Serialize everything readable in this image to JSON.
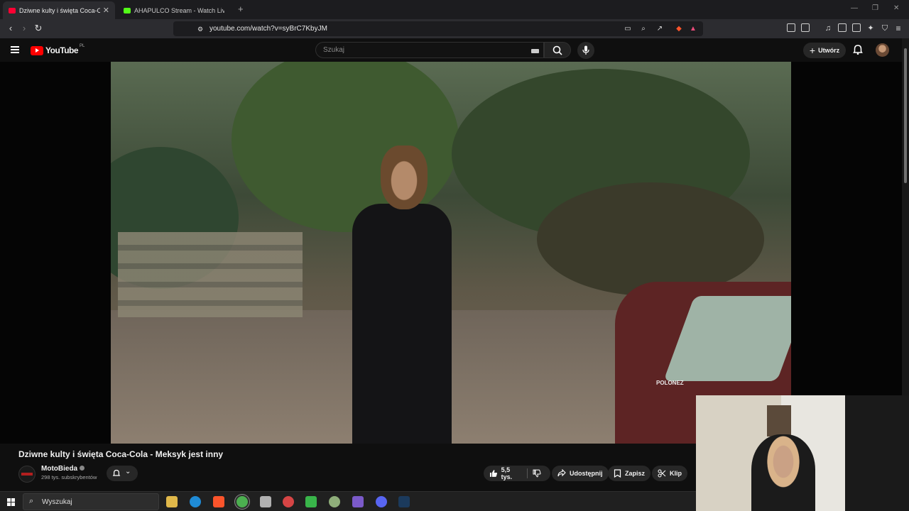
{
  "browser": {
    "tabs": [
      {
        "label": "Dziwne kulty i święta Coca-Cola - Meksyk jest inny",
        "favicon_color": "#ff0033",
        "active": true
      },
      {
        "label": "AHAPULCO Stream - Watch Live on Kick",
        "favicon_color": "#53fc18",
        "active": false
      }
    ],
    "new_tab": "+",
    "url": "youtube.com/watch?v=syBrC7KbyJM"
  },
  "youtube": {
    "logo_text": "YouTube",
    "country_code": "PL",
    "search_placeholder": "Szukaj",
    "create_label": "Utwórz"
  },
  "video": {
    "title": "Dziwne kulty i święta Coca-Cola - Meksyk jest inny",
    "channel_name": "MotoBieda",
    "subscribers": "298 tys. subskrybentów",
    "likes": "5,5 tys.",
    "share_label": "Udostępnij",
    "save_label": "Zapisz",
    "clip_label": "Klip",
    "car_text": "POLONEZ"
  },
  "taskbar": {
    "search_label": "Wyszukaj"
  },
  "colors": {
    "accent": "#ff0000",
    "background": "#0f0f0f",
    "pill": "#272727"
  }
}
